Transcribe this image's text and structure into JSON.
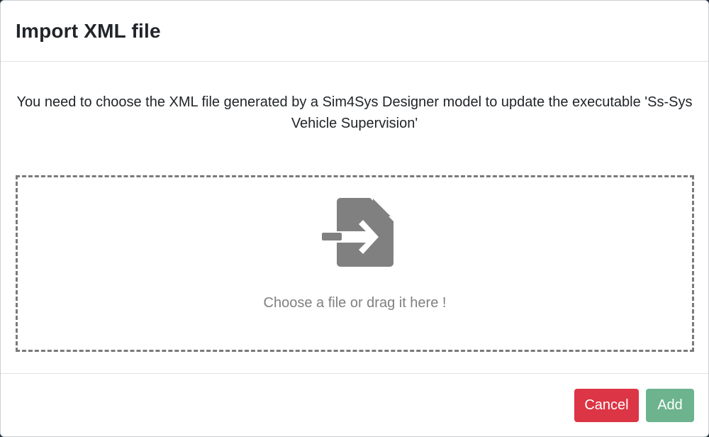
{
  "dialog": {
    "title": "Import XML file",
    "instruction": "You need to choose the XML file generated by a Sim4Sys Designer model to update the executable 'Ss-Sys Vehicle Supervision'",
    "dropzone": {
      "icon": "file-import-icon",
      "hint": "Choose a file or drag it here !"
    },
    "buttons": {
      "cancel_label": "Cancel",
      "add_label": "Add"
    }
  },
  "colors": {
    "cancel": "#dc3545",
    "add": "#6cb38e",
    "icon": "#808080",
    "dropzone_border": "#7a7a7a"
  }
}
